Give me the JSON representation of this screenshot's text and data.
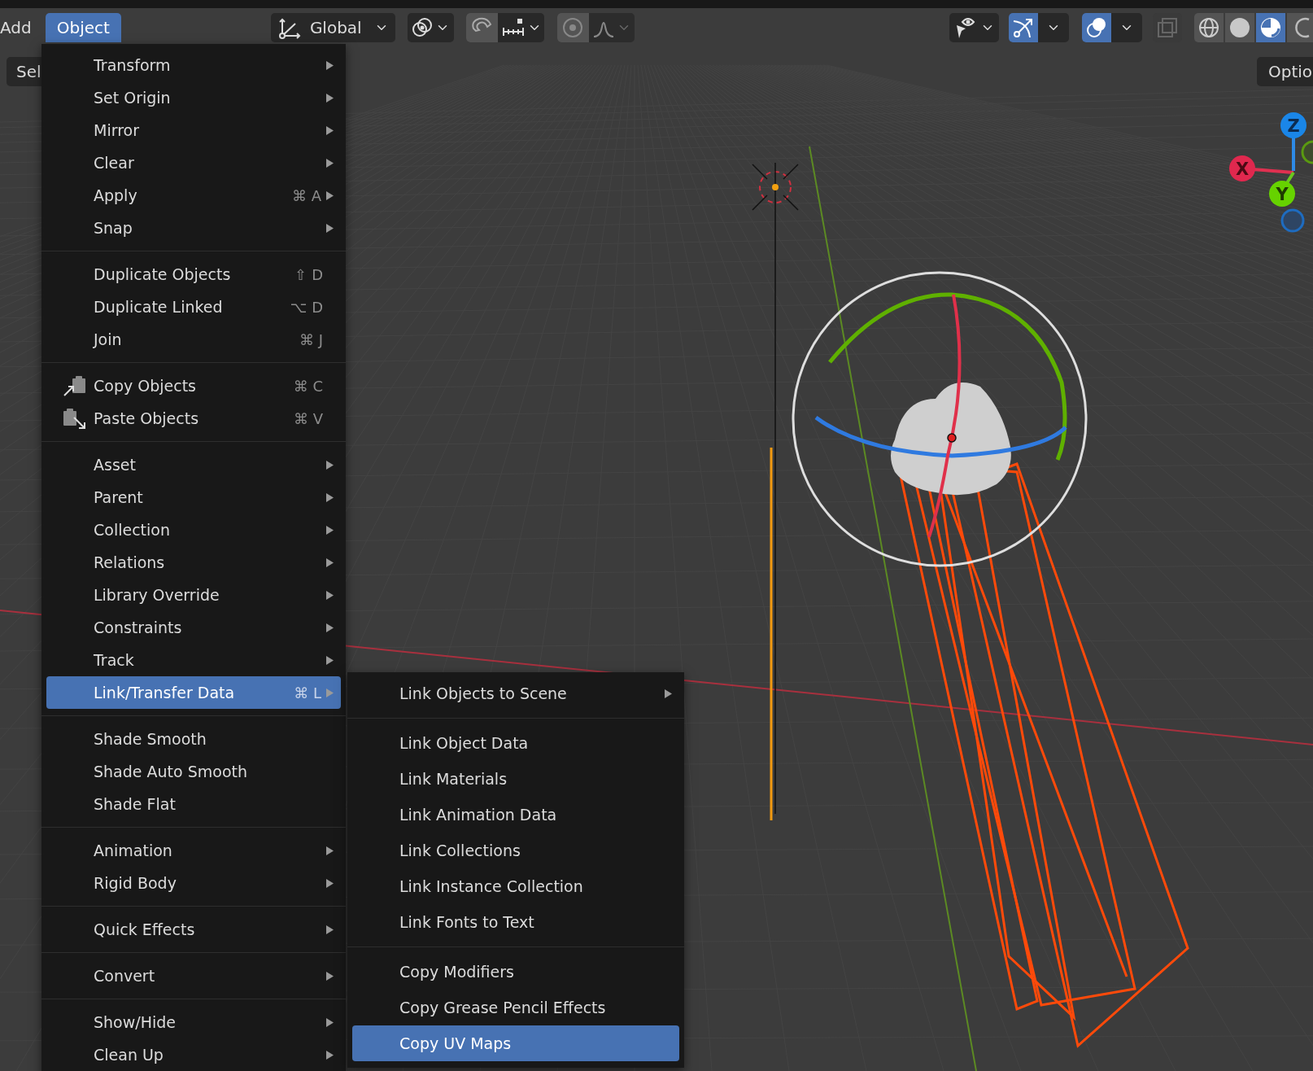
{
  "header": {
    "menus": [
      {
        "label": "Add",
        "selected": false
      },
      {
        "label": "Object",
        "selected": true
      }
    ],
    "orientation": "Global",
    "snap_on": false,
    "proportional_on": false,
    "gizmos_on": true,
    "overlays_on": true,
    "xray_on": false,
    "shading": [
      {
        "kind": "wireframe",
        "selected": false
      },
      {
        "kind": "solid",
        "selected": false
      },
      {
        "kind": "material",
        "selected": true
      },
      {
        "kind": "rendered",
        "selected": false
      }
    ]
  },
  "select_button": "Sel",
  "options_button": "Optio",
  "nav_gizmo": {
    "x": "X",
    "y": "Y",
    "z": "Z"
  },
  "object_menu": {
    "groups": [
      [
        {
          "kind": "item",
          "label": "Transform",
          "submenu": true,
          "selected": false
        },
        {
          "kind": "item",
          "label": "Set Origin",
          "submenu": true,
          "selected": false
        },
        {
          "kind": "item",
          "label": "Mirror",
          "submenu": true,
          "selected": false
        },
        {
          "kind": "item",
          "label": "Clear",
          "submenu": true,
          "selected": false
        },
        {
          "kind": "item",
          "label": "Apply",
          "shortcut": "⌘ A",
          "submenu": true,
          "selected": false
        },
        {
          "kind": "item",
          "label": "Snap",
          "submenu": true,
          "selected": false
        }
      ],
      [
        {
          "kind": "item",
          "label": "Duplicate Objects",
          "shortcut": "⇧ D",
          "submenu": false,
          "selected": false
        },
        {
          "kind": "item",
          "label": "Duplicate Linked",
          "shortcut": "⌥ D",
          "submenu": false,
          "selected": false
        },
        {
          "kind": "item",
          "label": "Join",
          "shortcut": "⌘ J",
          "submenu": false,
          "selected": false
        }
      ],
      [
        {
          "kind": "copy",
          "label": "Copy Objects",
          "shortcut": "⌘ C",
          "submenu": false,
          "selected": false
        },
        {
          "kind": "paste",
          "label": "Paste Objects",
          "shortcut": "⌘ V",
          "submenu": false,
          "selected": false
        }
      ],
      [
        {
          "kind": "item",
          "label": "Asset",
          "submenu": true,
          "selected": false
        },
        {
          "kind": "item",
          "label": "Parent",
          "submenu": true,
          "selected": false
        },
        {
          "kind": "item",
          "label": "Collection",
          "submenu": true,
          "selected": false
        },
        {
          "kind": "item",
          "label": "Relations",
          "submenu": true,
          "selected": false
        },
        {
          "kind": "item",
          "label": "Library Override",
          "submenu": true,
          "selected": false
        },
        {
          "kind": "item",
          "label": "Constraints",
          "submenu": true,
          "selected": false
        },
        {
          "kind": "item",
          "label": "Track",
          "submenu": true,
          "selected": false
        },
        {
          "kind": "item",
          "label": "Link/Transfer Data",
          "shortcut": "⌘ L",
          "submenu": true,
          "selected": true
        }
      ],
      [
        {
          "kind": "item",
          "label": "Shade Smooth",
          "submenu": false,
          "selected": false
        },
        {
          "kind": "item",
          "label": "Shade Auto Smooth",
          "submenu": false,
          "selected": false
        },
        {
          "kind": "item",
          "label": "Shade Flat",
          "submenu": false,
          "selected": false
        }
      ],
      [
        {
          "kind": "item",
          "label": "Animation",
          "submenu": true,
          "selected": false
        },
        {
          "kind": "item",
          "label": "Rigid Body",
          "submenu": true,
          "selected": false
        }
      ],
      [
        {
          "kind": "item",
          "label": "Quick Effects",
          "submenu": true,
          "selected": false
        }
      ],
      [
        {
          "kind": "item",
          "label": "Convert",
          "submenu": true,
          "selected": false
        }
      ],
      [
        {
          "kind": "item",
          "label": "Show/Hide",
          "submenu": true,
          "selected": false
        },
        {
          "kind": "item",
          "label": "Clean Up",
          "submenu": true,
          "selected": false
        }
      ]
    ]
  },
  "link_submenu": {
    "groups": [
      [
        {
          "label": "Link Objects to Scene",
          "submenu": true,
          "selected": false
        }
      ],
      [
        {
          "label": "Link Object Data",
          "submenu": false,
          "selected": false
        },
        {
          "label": "Link Materials",
          "submenu": false,
          "selected": false
        },
        {
          "label": "Link Animation Data",
          "submenu": false,
          "selected": false
        },
        {
          "label": "Link Collections",
          "submenu": false,
          "selected": false
        },
        {
          "label": "Link Instance Collection",
          "submenu": false,
          "selected": false
        },
        {
          "label": "Link Fonts to Text",
          "submenu": false,
          "selected": false
        }
      ],
      [
        {
          "label": "Copy Modifiers",
          "submenu": false,
          "selected": false
        },
        {
          "label": "Copy Grease Pencil Effects",
          "submenu": false,
          "selected": false
        },
        {
          "label": "Copy UV Maps",
          "submenu": false,
          "selected": true
        }
      ]
    ]
  }
}
